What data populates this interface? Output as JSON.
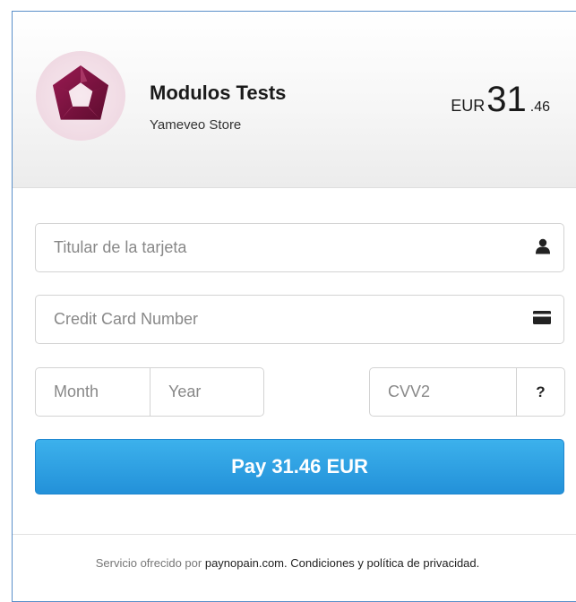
{
  "merchant": {
    "name": "Modulos Tests",
    "store": "Yameveo Store",
    "logo_icon": "pentagon-swirl-logo",
    "logo_color": "#7a1240"
  },
  "amount": {
    "currency": "EUR",
    "integer": "31",
    "decimal": ".46"
  },
  "form": {
    "holder_placeholder": "Titular de la tarjeta",
    "holder_icon": "user-icon",
    "card_placeholder": "Credit Card Number",
    "card_icon": "credit-card-icon",
    "month_placeholder": "Month",
    "year_placeholder": "Year",
    "cvv_placeholder": "CVV2",
    "cvv_help_label": "?",
    "pay_label": "Pay 31.46 EUR",
    "pay_color": "#2d9fe4"
  },
  "footer": {
    "prefix": "Servicio ofrecido por",
    "provider": "paynopain.com.",
    "terms": "Condiciones y política de privacidad."
  }
}
